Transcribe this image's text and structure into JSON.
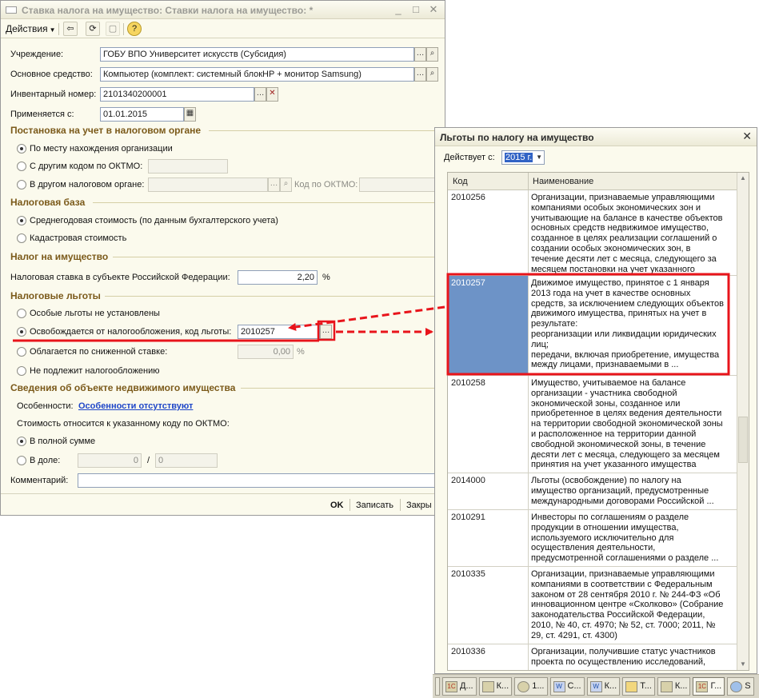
{
  "main_window": {
    "title": "Ставка налога на имущество: Ставки налога на имущество:",
    "title_modified_mark": "*",
    "toolbar": {
      "actions_label": "Действия",
      "help_glyph": "?"
    },
    "fields": {
      "institution_label": "Учреждение:",
      "institution_value": "ГОБУ ВПО Университет искусств (Субсидия)",
      "asset_label": "Основное средство:",
      "asset_value": "Компьютер (комплект: системный блокHP + монитор Samsung)",
      "inventory_label": "Инвентарный номер:",
      "inventory_value": "2101340200001",
      "applies_label": "Применяется с:",
      "applies_value": "01.01.2015"
    },
    "sections": {
      "registration": "Постановка на учет в налоговом органе",
      "tax_base": "Налоговая база",
      "property_tax": "Налог на имущество",
      "benefits": "Налоговые льготы",
      "real_estate": "Сведения об объекте недвижимого имущества"
    },
    "registration": {
      "opt_location": "По месту нахождения организации",
      "opt_other_oktmo": "С другим кодом по ОКТМО:",
      "opt_other_office": "В другом налоговом органе:",
      "oktmo_label": "Код по ОКТМО:"
    },
    "tax_base": {
      "opt_avg": "Среднегодовая стоимость (по данным бухгалтерского учета)",
      "opt_cadastral": "Кадастровая стоимость"
    },
    "property_tax": {
      "rate_label": "Налоговая ставка в субъекте Российской Федерации:",
      "rate_value": "2,20",
      "rate_unit": "%"
    },
    "benefits": {
      "opt_none": "Особые льготы не установлены",
      "opt_exempt": "Освобождается от налогообложения, код льготы:",
      "exempt_code": "2010257",
      "opt_reduced": "Облагается по сниженной ставке:",
      "reduced_value": "0,00",
      "reduced_unit": "%",
      "opt_not_taxed": "Не подлежит налогообложению"
    },
    "real_estate": {
      "features_label": "Особенности:",
      "features_link": "Особенности отсутствуют",
      "cost_label": "Стоимость относится к указанному коду по ОКТМО:",
      "opt_full": "В полной сумме",
      "opt_share": "В доле:",
      "share_num": "0",
      "share_sep": "/",
      "share_den": "0"
    },
    "comment_label": "Комментарий:",
    "buttons": {
      "ok": "OK",
      "save": "Записать",
      "close": "Закры"
    }
  },
  "benefits_window": {
    "title": "Льготы по налогу на имущество",
    "close_glyph": "✕",
    "valid_from_label": "Действует с:",
    "valid_from_value": "2015 г.",
    "columns": {
      "code": "Код",
      "name": "Наименование"
    },
    "rows": [
      {
        "code": "2010256",
        "name": "Организации, признаваемые управляющими\nкомпаниями особых экономических зон и\nучитывающие на балансе в качестве объектов\nосновных средств недвижимое имущество,\nсозданное в целях реализации соглашений о\nсоздании особых экономических зон, в\nтечение десяти лет с месяца, следующего за\nмесяцем постановки на учет указанного"
      },
      {
        "code": "2010257",
        "name": "Движимое имущество, принятое с 1 января\n2013 года на учет в качестве основных\nсредств, за исключением следующих объектов\nдвижимого имущества, принятых на учет в\nрезультате:\nреорганизации или ликвидации юридических\nлиц;\nпередачи, включая приобретение, имущества\nмежду лицами, признаваемыми в ..."
      },
      {
        "code": "2010258",
        "name": "Имущество, учитываемое на балансе\nорганизации - участника свободной\nэкономической зоны, созданное или\nприобретенное в целях ведения деятельности\nна территории свободной экономической зоны\nи расположенное на территории данной\nсвободной экономической зоны, в течение\nдесяти лет с месяца, следующего за месяцем\nпринятия на учет указанного имущества"
      },
      {
        "code": "2014000",
        "name": "Льготы (освобождение) по налогу на\nимущество организаций, предусмотренные\nмеждународными договорами Российской ..."
      },
      {
        "code": "2010291",
        "name": "Инвесторы по соглашениям о разделе\nпродукции в отношении имущества,\nиспользуемого исключительно для\nосуществления деятельности,\nпредусмотренной соглашениями о разделе ..."
      },
      {
        "code": "2010335",
        "name": "Организации, признаваемые управляющими\nкомпаниями в соответствии с Федеральным\nзаконом от 28 сентября 2010 г. № 244-ФЗ «Об\nинновационном центре «Сколково» (Собрание\nзаконодательства Российской Федерации,\n2010, № 40, ст. 4970; № 52, ст. 7000; 2011, №\n29, ст. 4291, ст. 4300)"
      },
      {
        "code": "2010336",
        "name": "Организации, получившие статус участников\nпроекта по осуществлению исследований,"
      }
    ]
  },
  "taskbar": {
    "items": [
      {
        "label": "Д..."
      },
      {
        "label": "К..."
      },
      {
        "label": "1..."
      },
      {
        "label": "С..."
      },
      {
        "label": "К..."
      },
      {
        "label": "Т..."
      },
      {
        "label": "К..."
      },
      {
        "label": "Г..."
      },
      {
        "label": "S"
      }
    ]
  },
  "colors": {
    "accent_highlight": "#e8141b",
    "selection": "#6d93c7",
    "section_title": "#7b5a1a",
    "link": "#1e46c8"
  }
}
